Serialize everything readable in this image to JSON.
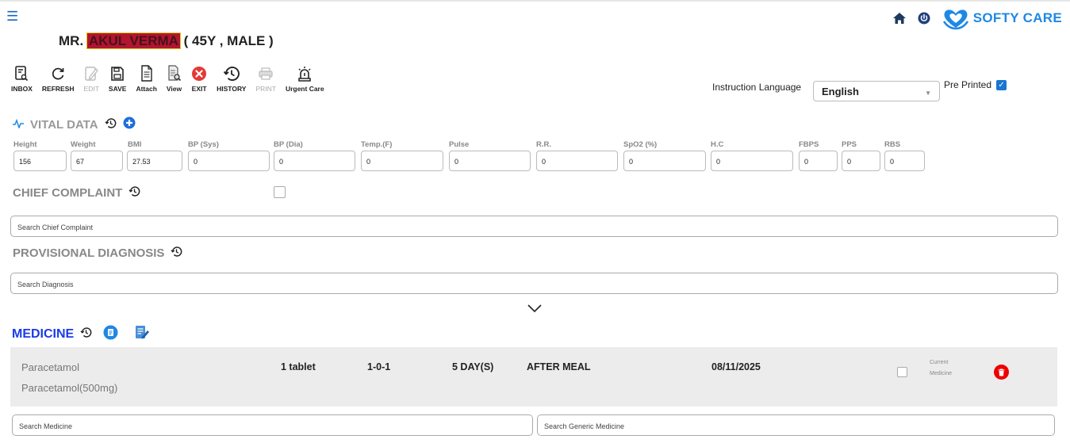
{
  "patient": {
    "title_prefix": "MR.",
    "name_redacted": "AKUL VERMA",
    "details": "( 45Y , MALE )"
  },
  "brand": {
    "name": "SOFTY CARE",
    "color": "#1e88e5"
  },
  "toolbar": {
    "inbox": "INBOX",
    "refresh": "REFRESH",
    "edit": "EDIT",
    "save": "SAVE",
    "attach": "Attach",
    "view": "View",
    "exit": "EXIT",
    "history": "HISTORY",
    "print": "PRINT",
    "urgent": "Urgent Care"
  },
  "language": {
    "label": "Instruction Language",
    "selected": "English"
  },
  "preprinted": {
    "label": "Pre Printed",
    "checked": true
  },
  "vitals": {
    "title": "VITAL DATA",
    "fields": [
      {
        "label": "Height",
        "value": "156"
      },
      {
        "label": "Weight",
        "value": "67"
      },
      {
        "label": "BMI",
        "value": "27.53"
      },
      {
        "label": "BP (Sys)",
        "value": "0"
      },
      {
        "label": "BP (Dia)",
        "value": "0"
      },
      {
        "label": "Temp.(F)",
        "value": "0"
      },
      {
        "label": "Pulse",
        "value": "0"
      },
      {
        "label": "R.R.",
        "value": "0"
      },
      {
        "label": "SpO2 (%)",
        "value": "0"
      },
      {
        "label": "H.C",
        "value": "0"
      },
      {
        "label": "FBPS",
        "value": "0"
      },
      {
        "label": "PPS",
        "value": "0"
      },
      {
        "label": "RBS",
        "value": "0"
      }
    ]
  },
  "chief_complaint": {
    "title": "CHIEF COMPLAINT",
    "placeholder": "Search Chief Complaint"
  },
  "diagnosis": {
    "title": "PROVISIONAL DIAGNOSIS",
    "placeholder": "Search Diagnosis"
  },
  "medicine": {
    "title": "MEDICINE",
    "rows": [
      {
        "name": "Paracetamol",
        "generic": "Paracetamol(500mg)",
        "dose": "1 tablet",
        "frequency": "1-0-1",
        "duration": "5 DAY(S)",
        "timing": "AFTER MEAL",
        "date": "08/11/2025",
        "current_label": "Current Medicine"
      }
    ],
    "search_placeholder": "Search Medicine",
    "generic_placeholder": "Search Generic Medicine"
  },
  "colors": {
    "accent": "#1565c0",
    "heading_blue": "#1a3be8",
    "danger": "#e00000"
  }
}
